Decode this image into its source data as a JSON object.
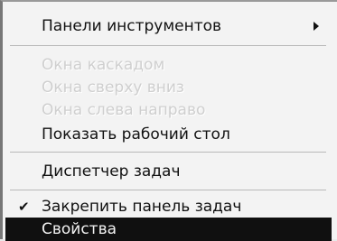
{
  "menu": {
    "items": [
      {
        "label": "Панели инструментов",
        "enabled": true
      },
      {
        "label": "Окна каскадом",
        "enabled": false
      },
      {
        "label": "Окна сверху вниз",
        "enabled": false
      },
      {
        "label": "Окна слева направо",
        "enabled": false
      },
      {
        "label": "Показать рабочий стол",
        "enabled": true
      },
      {
        "label": "Диспетчер задач",
        "enabled": true
      },
      {
        "label": "Закрепить панель задач",
        "enabled": true,
        "checked": true
      },
      {
        "label": "Свойства",
        "enabled": true,
        "highlighted": true
      }
    ],
    "submenu_icon": "chevron-right-icon",
    "check_icon": "checkmark-icon"
  }
}
